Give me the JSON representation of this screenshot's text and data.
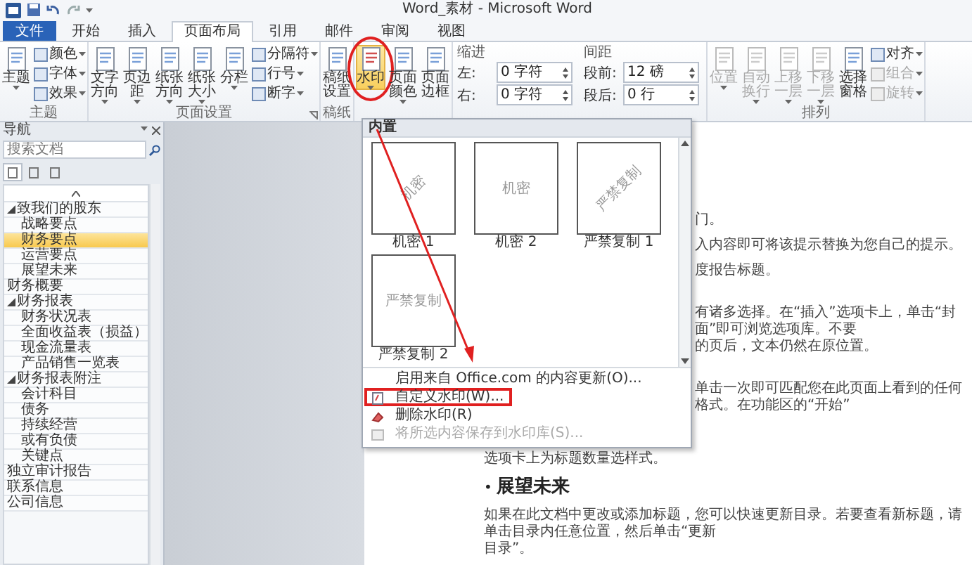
{
  "title_bar": {
    "title": "Word_素材 - Microsoft Word"
  },
  "tabs": [
    {
      "label": "文件",
      "kind": "file",
      "selected": false
    },
    {
      "label": "开始",
      "kind": "tab",
      "selected": false
    },
    {
      "label": "插入",
      "kind": "tab",
      "selected": false
    },
    {
      "label": "页面布局",
      "kind": "tab",
      "selected": true
    },
    {
      "label": "引用",
      "kind": "tab",
      "selected": false
    },
    {
      "label": "邮件",
      "kind": "tab",
      "selected": false
    },
    {
      "label": "审阅",
      "kind": "tab",
      "selected": false
    },
    {
      "label": "视图",
      "kind": "tab",
      "selected": false
    }
  ],
  "ribbon": {
    "groups": [
      {
        "label": "主题",
        "items": [
          {
            "kind": "large",
            "label": "主题",
            "dropdown": true
          },
          {
            "kind": "stack",
            "items": [
              {
                "label": "颜色",
                "dropdown": true
              },
              {
                "label": "字体",
                "dropdown": true
              },
              {
                "label": "效果",
                "dropdown": true
              }
            ]
          }
        ]
      },
      {
        "label": "页面设置",
        "launcher": true,
        "items": [
          {
            "kind": "large",
            "label": "文字方向",
            "dropdown": true
          },
          {
            "kind": "large",
            "label": "页边距",
            "dropdown": true
          },
          {
            "kind": "large",
            "label": "纸张方向",
            "dropdown": true
          },
          {
            "kind": "large",
            "label": "纸张大小",
            "dropdown": true
          },
          {
            "kind": "large",
            "label": "分栏",
            "dropdown": true
          },
          {
            "kind": "stack",
            "items": [
              {
                "label": "分隔符",
                "dropdown": true
              },
              {
                "label": "行号",
                "dropdown": true
              },
              {
                "label": "断字",
                "dropdown": true
              }
            ]
          }
        ]
      },
      {
        "label": "稿纸",
        "items": [
          {
            "kind": "large",
            "label": "稿纸设置",
            "dropdown": false
          }
        ]
      },
      {
        "items": [
          {
            "kind": "large",
            "label": "水印",
            "dropdown": true,
            "pressed": true,
            "circled": true
          },
          {
            "kind": "large",
            "label": "页面颜色",
            "dropdown": true,
            "pressed": false,
            "circled": false
          },
          {
            "kind": "large",
            "label": "页面边框",
            "dropdown": false,
            "pressed": false,
            "circled": false
          }
        ]
      },
      {
        "items": [
          {
            "kind": "spin",
            "heading": "缩进",
            "rows": [
              {
                "label": "左:",
                "value": "0 字符"
              },
              {
                "label": "右:",
                "value": "0 字符"
              }
            ]
          },
          {
            "kind": "spin",
            "heading": "间距",
            "rows": [
              {
                "label": "段前:",
                "value": "12 磅"
              },
              {
                "label": "段后:",
                "value": "0 行"
              }
            ]
          }
        ]
      },
      {
        "label": "排列",
        "items": [
          {
            "kind": "large",
            "label": "位置",
            "dropdown": true,
            "disabled": true
          },
          {
            "kind": "large",
            "label": "自动换行",
            "dropdown": true,
            "disabled": true
          },
          {
            "kind": "large",
            "label": "上移一层",
            "dropdown": true,
            "disabled": true
          },
          {
            "kind": "large",
            "label": "下移一层",
            "dropdown": true,
            "disabled": true
          },
          {
            "kind": "large",
            "label": "选择窗格",
            "dropdown": false,
            "disabled": false
          },
          {
            "kind": "stack",
            "items": [
              {
                "label": "对齐",
                "dropdown": true,
                "disabled": false
              },
              {
                "label": "组合",
                "dropdown": true,
                "disabled": true
              },
              {
                "label": "旋转",
                "dropdown": true,
                "disabled": true
              }
            ]
          }
        ]
      }
    ]
  },
  "nav": {
    "title": "导航",
    "search": {
      "placeholder": "搜索文档"
    },
    "view_tabs": [
      {
        "selected": true
      },
      {
        "selected": false
      },
      {
        "selected": false
      }
    ],
    "tree": [
      {
        "label": "致我们的股东",
        "expanded": true,
        "selected": false,
        "children": [
          {
            "label": "战略要点",
            "selected": false
          },
          {
            "label": "财务要点",
            "selected": true
          },
          {
            "label": "运营要点",
            "selected": false
          },
          {
            "label": "展望未来",
            "selected": false
          }
        ]
      },
      {
        "label": "财务概要",
        "selected": false
      },
      {
        "label": "财务报表",
        "expanded": true,
        "selected": false,
        "children": [
          {
            "label": "财务状况表",
            "selected": false
          },
          {
            "label": "全面收益表（损益）",
            "selected": false
          },
          {
            "label": "现金流量表",
            "selected": false
          },
          {
            "label": "产品销售一览表",
            "selected": false
          }
        ]
      },
      {
        "label": "财务报表附注",
        "expanded": true,
        "selected": false,
        "children": [
          {
            "label": "会计科目",
            "selected": false
          },
          {
            "label": "债务",
            "selected": false
          },
          {
            "label": "持续经营",
            "selected": false
          },
          {
            "label": "或有负债",
            "selected": false
          },
          {
            "label": "关键点",
            "selected": false
          }
        ]
      },
      {
        "label": "独立审计报告",
        "selected": false
      },
      {
        "label": "联系信息",
        "selected": false
      },
      {
        "label": "公司信息",
        "selected": false
      }
    ]
  },
  "watermark_menu": {
    "header": "内置",
    "pointer_arrow": true,
    "thumbnails": [
      {
        "label": "机密 1",
        "watermark": "机密",
        "diagonal": true
      },
      {
        "label": "机密 2",
        "watermark": "机密",
        "diagonal": false
      },
      {
        "label": "严禁复制 1",
        "watermark": "严禁复制",
        "diagonal": true
      },
      {
        "label": "严禁复制 2",
        "watermark": "严禁复制",
        "diagonal": false
      }
    ],
    "items": [
      {
        "label": "启用来自 Office.com 的内容更新(O)...",
        "kind": "plain",
        "disabled": false,
        "boxed": false
      },
      {
        "label": "自定义水印(W)...",
        "kind": "custom",
        "disabled": false,
        "boxed": true
      },
      {
        "label": "删除水印(R)",
        "kind": "remove",
        "disabled": false,
        "boxed": false
      },
      {
        "label": "将所选内容保存到水印库(S)...",
        "kind": "save",
        "disabled": true,
        "boxed": false
      }
    ]
  },
  "document": {
    "sections": [
      {
        "blocks": [
          {
            "kind": "para",
            "lines": [
              {
                "text": "门。",
                "covered": true
              }
            ]
          },
          {
            "kind": "para",
            "lines": [
              {
                "text": "入内容即可将该提示替换为您自己的提示。",
                "covered": true
              }
            ]
          },
          {
            "kind": "para",
            "lines": [
              {
                "text": "度报告标题。",
                "covered": true
              }
            ]
          }
        ]
      },
      {
        "blocks": [
          {
            "kind": "para",
            "lines": [
              {
                "text": "有诸多选择。在“插入”选项卡上，单击“封面”即可浏览选项库。不要",
                "covered": true
              },
              {
                "text": "的页后，文本仍然在原位置。",
                "covered": true
              }
            ]
          }
        ]
      },
      {
        "blocks": [
          {
            "kind": "para",
            "lines": [
              {
                "text": "单击一次即可匹配您在此页面上看到的任何格式。在功能区的“开始”",
                "covered": true
              },
              {
                "text": "选项卡上为标题数量选样式。",
                "covered": false
              }
            ]
          },
          {
            "kind": "heading",
            "bullet": "•",
            "text": "展望未来"
          },
          {
            "kind": "para",
            "lines": [
              {
                "text": "如果在此文档中更改或添加标题，您可以快速更新目录。若要查看新标题，请单击目录内任意位置，然后单击“更新",
                "covered": false
              },
              {
                "text": "目录”。",
                "covered": false
              }
            ]
          }
        ]
      }
    ]
  }
}
